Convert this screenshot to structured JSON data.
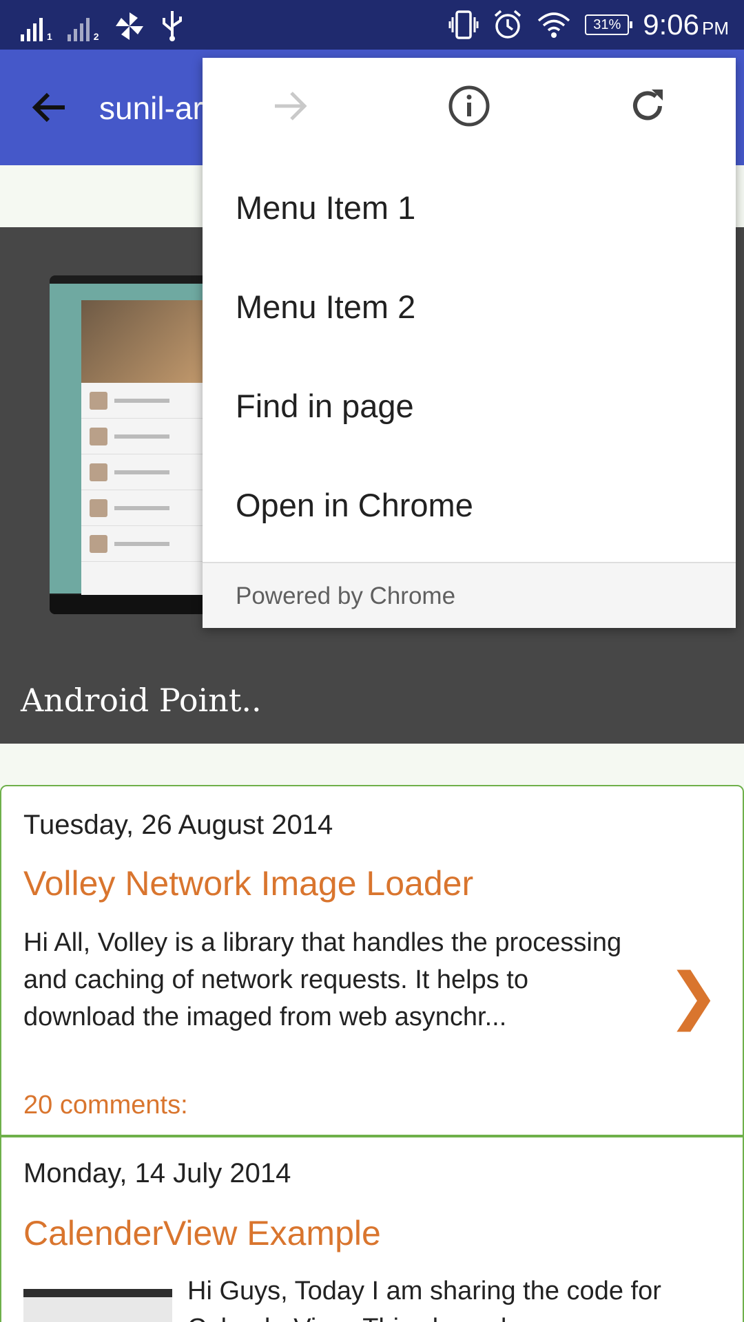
{
  "status_bar": {
    "sim1": "1",
    "sim2": "2",
    "battery": "31%",
    "time": "9:06",
    "ampm": "PM",
    "icons": [
      "signal-icon",
      "signal-icon",
      "pinwheel-icon",
      "usb-icon",
      "vibrate-icon",
      "alarm-icon",
      "wifi-icon",
      "battery-icon"
    ]
  },
  "toolbar": {
    "title": "sunil-ar"
  },
  "hero": {
    "title": "Android Point.."
  },
  "menu": {
    "items": [
      {
        "label": "Menu Item 1"
      },
      {
        "label": "Menu Item 2"
      },
      {
        "label": "Find in page"
      },
      {
        "label": "Open in Chrome"
      }
    ],
    "footer": "Powered by Chrome",
    "icons": [
      "forward-icon",
      "info-icon",
      "refresh-icon"
    ]
  },
  "posts": [
    {
      "date": "Tuesday, 26 August 2014",
      "title": "Volley Network Image Loader",
      "excerpt": "Hi All, Volley is a library that handles the processing and caching of network requests. It helps to download the imaged from web asynchr...",
      "comments": "20 comments:",
      "arrow": "❯"
    },
    {
      "date": "Monday, 14 July 2014",
      "title": "CalenderView Example",
      "excerpt": "Hi Guys, Today I am sharing the code for CalenderView. This shows how..."
    }
  ],
  "colors": {
    "status_bar": "#1f2a6e",
    "toolbar": "#4558c9",
    "accent": "#d9752e",
    "post_border": "#6eb04a",
    "hero": "#474747"
  }
}
